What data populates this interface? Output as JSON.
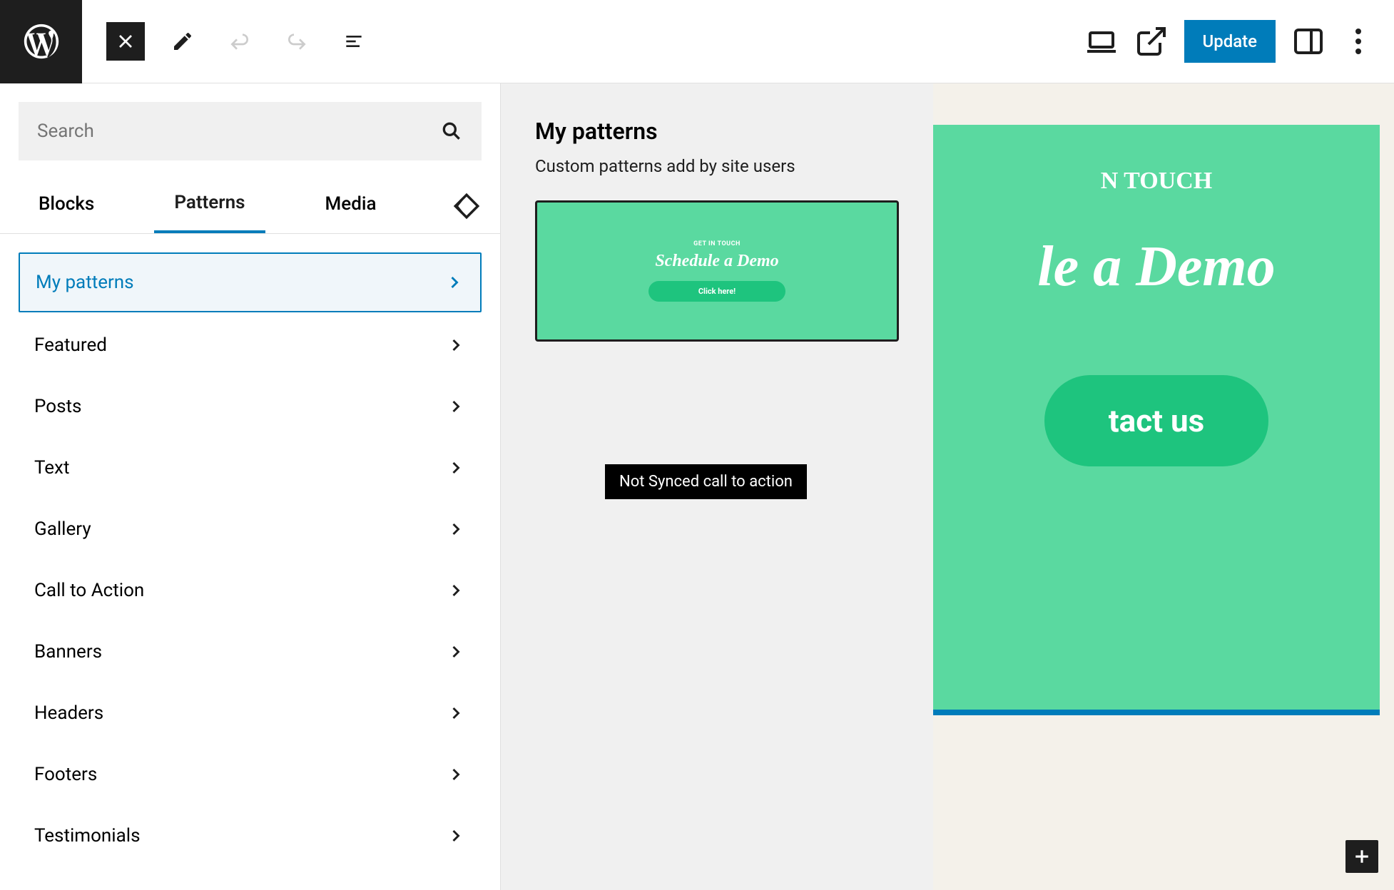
{
  "toolbar": {
    "update_label": "Update"
  },
  "inserter": {
    "search_placeholder": "Search",
    "tabs": [
      "Blocks",
      "Patterns",
      "Media"
    ],
    "active_tab": "Patterns",
    "categories": [
      {
        "label": "My patterns",
        "selected": true
      },
      {
        "label": "Featured"
      },
      {
        "label": "Posts"
      },
      {
        "label": "Text"
      },
      {
        "label": "Gallery"
      },
      {
        "label": "Call to Action"
      },
      {
        "label": "Banners"
      },
      {
        "label": "Headers"
      },
      {
        "label": "Footers"
      },
      {
        "label": "Testimonials"
      }
    ]
  },
  "panel": {
    "title": "My patterns",
    "subtitle": "Custom patterns add by site users",
    "pattern_preview": {
      "kicker": "GET IN TOUCH",
      "headline": "Schedule a Demo",
      "cta": "Click here!"
    },
    "tooltip": "Not Synced call to action"
  },
  "canvas": {
    "kicker": "N TOUCH",
    "headline": "le a Demo",
    "cta": "tact us"
  },
  "colors": {
    "accent_blue": "#007cba",
    "green_light": "#5ad9a0",
    "green_dark": "#1ec47e",
    "canvas_bg": "#f4f1ea"
  }
}
